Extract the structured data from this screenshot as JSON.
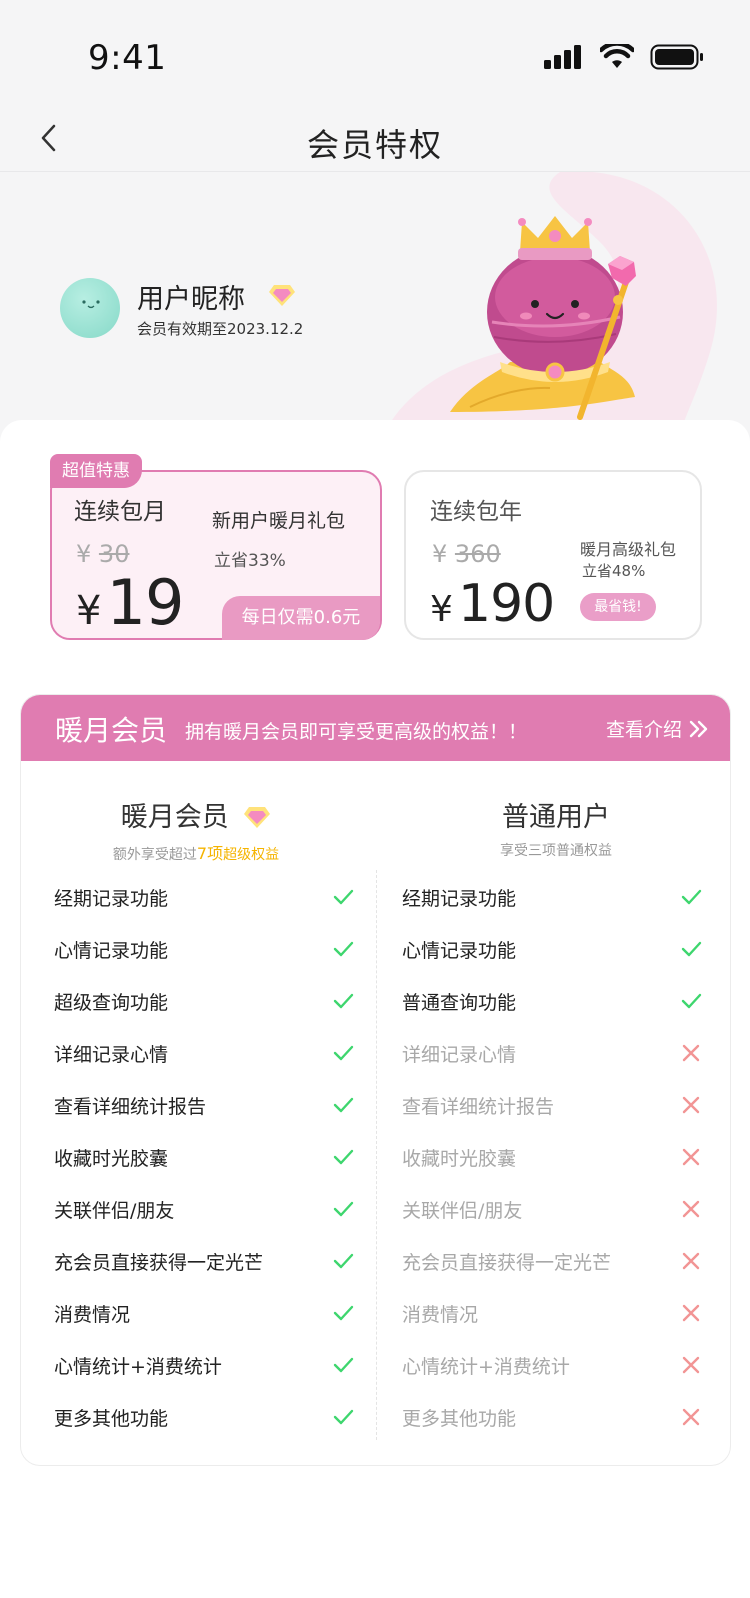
{
  "status": {
    "time": "9:41"
  },
  "nav": {
    "title": "会员特权"
  },
  "user": {
    "nickname": "用户昵称",
    "expire": "会员有效期至2023.12.2"
  },
  "plans": {
    "month": {
      "tag": "超值特惠",
      "name": "连续包月",
      "yen": "¥",
      "old_price": "30",
      "price": "19",
      "gift": "新用户暖月礼包",
      "save": "立省33%",
      "daily": "每日仅需0.6元"
    },
    "year": {
      "name": "连续包年",
      "yen": "¥",
      "old_price": "360",
      "price": "190",
      "gift": "暖月高级礼包",
      "save": "立省48%",
      "badge": "最省钱!"
    }
  },
  "compare": {
    "title": "暖月会员",
    "desc": "拥有暖月会员即可享受更高级的权益！！",
    "link": "查看介绍",
    "vip": {
      "title": "暖月会员",
      "sub_prefix": "额外享受超过",
      "sub_highlight": "7项",
      "sub_suffix": "超级权益",
      "features": [
        {
          "label": "经期记录功能",
          "ok": true
        },
        {
          "label": "心情记录功能",
          "ok": true
        },
        {
          "label": "超级查询功能",
          "ok": true
        },
        {
          "label": "详细记录心情",
          "ok": true
        },
        {
          "label": "查看详细统计报告",
          "ok": true
        },
        {
          "label": "收藏时光胶囊",
          "ok": true
        },
        {
          "label": "关联伴侣/朋友",
          "ok": true
        },
        {
          "label": "充会员直接获得一定光芒",
          "ok": true
        },
        {
          "label": "消费情况",
          "ok": true
        },
        {
          "label": "心情统计+消费统计",
          "ok": true
        },
        {
          "label": "更多其他功能",
          "ok": true
        }
      ]
    },
    "normal": {
      "title": "普通用户",
      "sub": "享受三项普通权益",
      "features": [
        {
          "label": "经期记录功能",
          "ok": true
        },
        {
          "label": "心情记录功能",
          "ok": true
        },
        {
          "label": "普通查询功能",
          "ok": true
        },
        {
          "label": "详细记录心情",
          "ok": false
        },
        {
          "label": "查看详细统计报告",
          "ok": false
        },
        {
          "label": "收藏时光胶囊",
          "ok": false
        },
        {
          "label": "关联伴侣/朋友",
          "ok": false
        },
        {
          "label": "充会员直接获得一定光芒",
          "ok": false
        },
        {
          "label": "消费情况",
          "ok": false
        },
        {
          "label": "心情统计+消费统计",
          "ok": false
        },
        {
          "label": "更多其他功能",
          "ok": false
        }
      ]
    }
  },
  "colors": {
    "accent": "#e07cb1",
    "check": "#3ed66e",
    "cross": "#f29494",
    "gold": "#f5b400"
  },
  "icons": {
    "back": "chevron-left-icon",
    "diamond": "diamond-icon",
    "check": "check-icon",
    "cross": "cross-icon",
    "more": "double-chevron-right-icon"
  }
}
